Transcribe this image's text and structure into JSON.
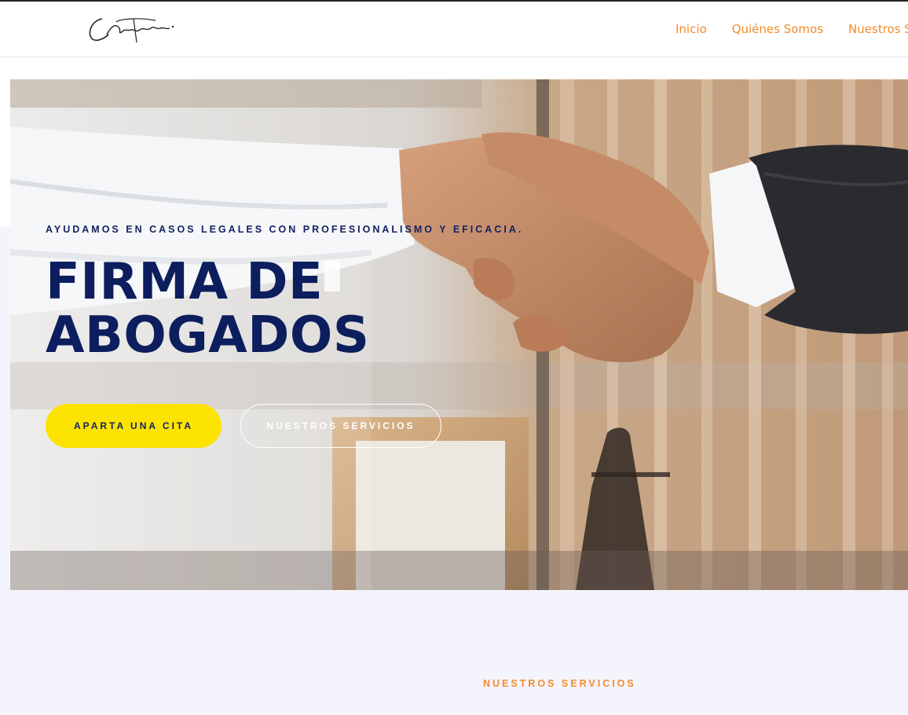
{
  "header": {
    "logo_alt": "signature-logo",
    "nav": [
      {
        "label": "Inicio"
      },
      {
        "label": "Quiénes Somos"
      },
      {
        "label": "Nuestros Servicios"
      }
    ]
  },
  "hero": {
    "eyebrow": "AYUDAMOS EN CASOS LEGALES CON PROFESIONALISMO Y EFICACIA.",
    "title_line1": "FIRMA DE",
    "title_line2": "ABOGADOS",
    "primary_button": "APARTA UNA CITA",
    "secondary_button": "NUESTROS SERVICIOS",
    "image": "handshake-photo"
  },
  "services": {
    "eyebrow": "NUESTROS SERVICIOS"
  },
  "colors": {
    "accent_orange": "#f28c2e",
    "navy": "#0c1e5e",
    "yellow": "#fde300",
    "page_bg": "#f4f4fc"
  }
}
